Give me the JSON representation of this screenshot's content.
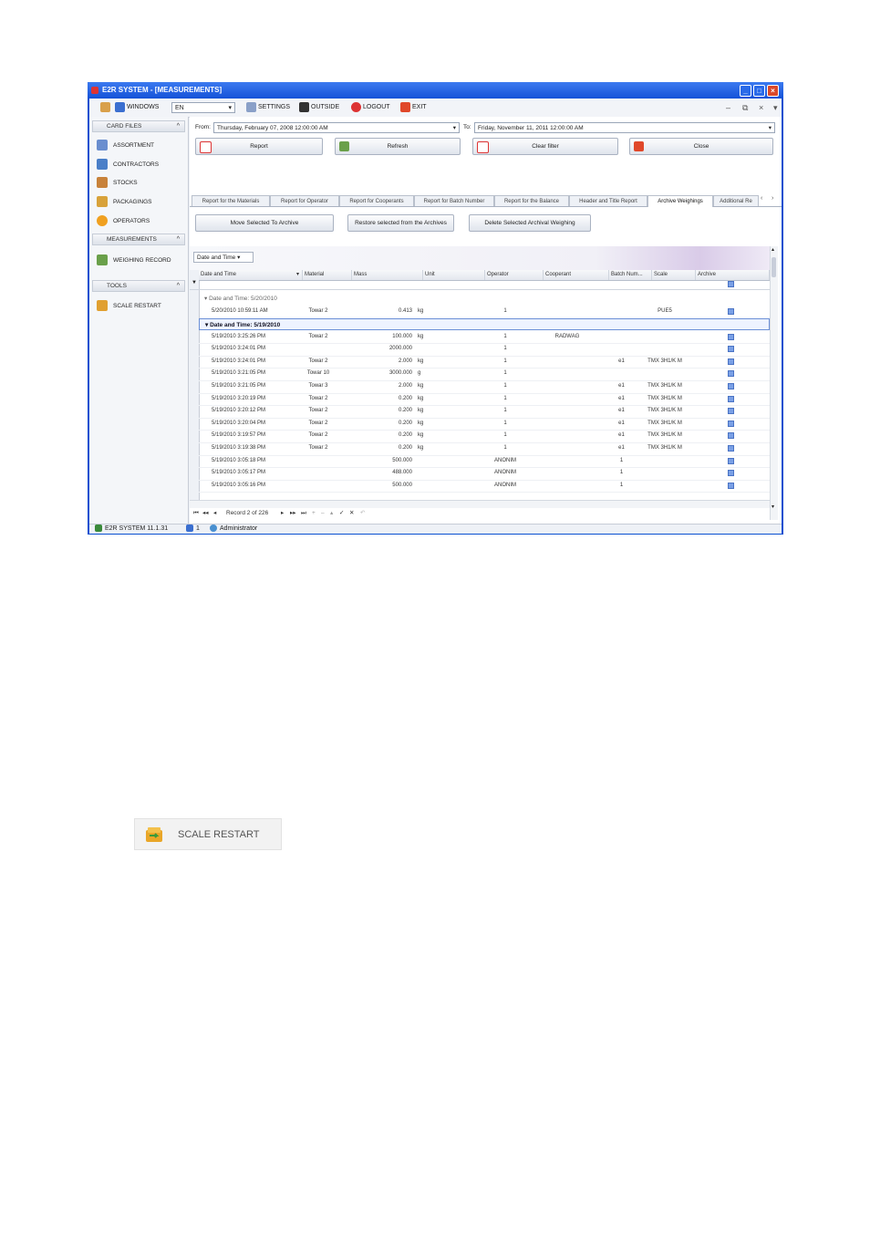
{
  "window": {
    "title": "E2R SYSTEM - [MEASUREMENTS]",
    "controls": [
      "_",
      "□",
      "×"
    ]
  },
  "menu": {
    "windows": "WINDOWS",
    "language": "EN",
    "settings": "SETTINGS",
    "outside": "OUTSIDE",
    "logout": "LOGOUT",
    "exit": "EXIT",
    "mdi_controls": [
      "–",
      "⧉",
      "×",
      "▾"
    ]
  },
  "sidebar": {
    "groups": {
      "card_files": "CARD FILES",
      "measurements": "MEASUREMENTS",
      "tools": "TOOLS"
    },
    "items": [
      {
        "label": "ASSORTMENT",
        "icon": "assortment-icon"
      },
      {
        "label": "CONTRACTORS",
        "icon": "contractors-icon"
      },
      {
        "label": "STOCKS",
        "icon": "stocks-icon"
      },
      {
        "label": "PACKAGINGS",
        "icon": "packagings-icon"
      },
      {
        "label": "OPERATORS",
        "icon": "operators-icon"
      },
      {
        "label": "WEIGHING RECORD",
        "icon": "weighing-record-icon"
      },
      {
        "label": "SCALE RESTART",
        "icon": "scale-restart-icon"
      }
    ]
  },
  "filter": {
    "from_label": "From:",
    "from_value": "Thursday, February 07, 2008 12:00:00 AM",
    "to_label": "To:",
    "to_value": "Friday, November 11, 2011 12:00:00 AM"
  },
  "actions": {
    "report": "Report",
    "refresh": "Refresh",
    "clear_filter": "Clear filter",
    "close": "Close"
  },
  "tabs": [
    "Report for the Materials",
    "Report for Operator",
    "Report for Cooperants",
    "Report for Batch Number",
    "Report for the Balance",
    "Header and Title Report",
    "Archive Weighings",
    "Additional Re"
  ],
  "active_tab": "Archive Weighings",
  "archive_actions": {
    "move": "Move Selected To Archive",
    "restore": "Restore selected from the Archives",
    "delete": "Delete Selected Archival Weighing"
  },
  "group_by": "Date and Time",
  "columns": [
    "Date and Time",
    "Material",
    "Mass",
    "Unit",
    "Operator",
    "Cooperant",
    "Batch Num...",
    "Scale",
    "Archive"
  ],
  "groups": [
    {
      "label": "Date and Time: 5/20/2010",
      "rows": [
        {
          "date": "5/20/2010 10:59:11 AM",
          "material": "Towar 2",
          "mass": "0.413",
          "unit": "kg",
          "operator": "1",
          "cooperant": "",
          "batch": "",
          "scale": "PUE5"
        }
      ]
    },
    {
      "label": "Date and Time: 5/19/2010",
      "rows": [
        {
          "date": "5/19/2010 3:25:26 PM",
          "material": "Towar 2",
          "mass": "100.000",
          "unit": "kg",
          "operator": "1",
          "cooperant": "RADWAG",
          "batch": "",
          "scale": ""
        },
        {
          "date": "5/19/2010 3:24:01 PM",
          "material": "",
          "mass": "2000.000",
          "unit": "",
          "operator": "1",
          "cooperant": "",
          "batch": "",
          "scale": ""
        },
        {
          "date": "5/19/2010 3:24:01 PM",
          "material": "Towar 2",
          "mass": "2.000",
          "unit": "kg",
          "operator": "1",
          "cooperant": "",
          "batch": "e1",
          "scale": "TMX 3H1/K M"
        },
        {
          "date": "5/19/2010 3:21:05 PM",
          "material": "Towar 10",
          "mass": "3000.000",
          "unit": "g",
          "operator": "1",
          "cooperant": "",
          "batch": "",
          "scale": ""
        },
        {
          "date": "5/19/2010 3:21:05 PM",
          "material": "Towar 3",
          "mass": "2.000",
          "unit": "kg",
          "operator": "1",
          "cooperant": "",
          "batch": "e1",
          "scale": "TMX 3H1/K M"
        },
        {
          "date": "5/19/2010 3:20:19 PM",
          "material": "Towar 2",
          "mass": "0.200",
          "unit": "kg",
          "operator": "1",
          "cooperant": "",
          "batch": "e1",
          "scale": "TMX 3H1/K M"
        },
        {
          "date": "5/19/2010 3:20:12 PM",
          "material": "Towar 2",
          "mass": "0.200",
          "unit": "kg",
          "operator": "1",
          "cooperant": "",
          "batch": "e1",
          "scale": "TMX 3H1/K M"
        },
        {
          "date": "5/19/2010 3:20:04 PM",
          "material": "Towar 2",
          "mass": "0.200",
          "unit": "kg",
          "operator": "1",
          "cooperant": "",
          "batch": "e1",
          "scale": "TMX 3H1/K M"
        },
        {
          "date": "5/19/2010 3:19:57 PM",
          "material": "Towar 2",
          "mass": "0.200",
          "unit": "kg",
          "operator": "1",
          "cooperant": "",
          "batch": "e1",
          "scale": "TMX 3H1/K M"
        },
        {
          "date": "5/19/2010 3:19:38 PM",
          "material": "Towar 2",
          "mass": "0.200",
          "unit": "kg",
          "operator": "1",
          "cooperant": "",
          "batch": "e1",
          "scale": "TMX 3H1/K M"
        },
        {
          "date": "5/19/2010 3:05:18 PM",
          "material": "",
          "mass": "500.000",
          "unit": "",
          "operator": "ANONIM",
          "cooperant": "",
          "batch": "1",
          "scale": ""
        },
        {
          "date": "5/19/2010 3:05:17 PM",
          "material": "",
          "mass": "488.000",
          "unit": "",
          "operator": "ANONIM",
          "cooperant": "",
          "batch": "1",
          "scale": ""
        },
        {
          "date": "5/19/2010 3:05:16 PM",
          "material": "",
          "mass": "500.000",
          "unit": "",
          "operator": "ANONIM",
          "cooperant": "",
          "batch": "1",
          "scale": ""
        }
      ]
    }
  ],
  "navigator": {
    "record_text": "Record 2 of 226",
    "buttons": [
      "⏮",
      "◂◂",
      "◂",
      "▸",
      "▸▸",
      "⏭",
      "+",
      "–",
      "▴",
      "✓",
      "✕",
      "↶"
    ]
  },
  "status": {
    "app": "E2R SYSTEM 11.1.31",
    "users": "1",
    "user": "Administrator"
  },
  "scale_restart_button": {
    "label": "SCALE RESTART",
    "icon": "scale-restart-icon"
  },
  "colors": {
    "title_bar": "#1552d8",
    "window_frame": "#0a4fd0",
    "panel": "#eef1f6",
    "close_button": "#d9482a"
  }
}
